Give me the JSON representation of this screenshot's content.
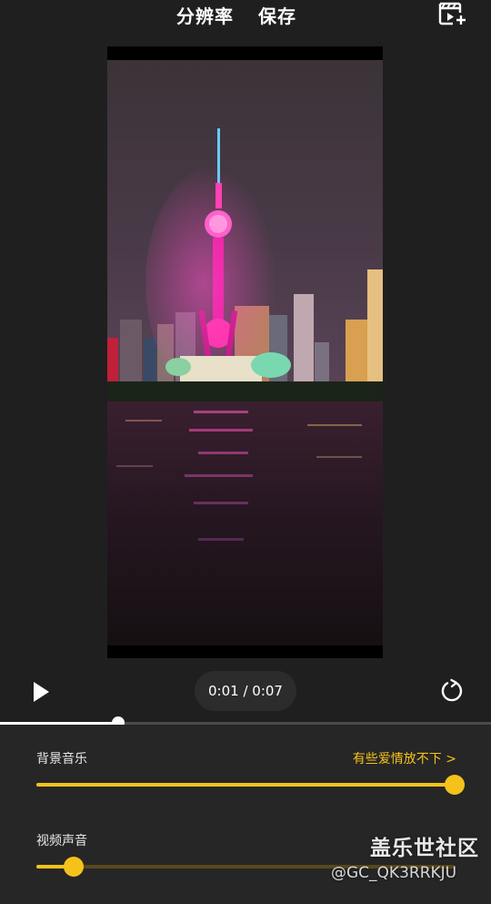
{
  "header": {
    "resolution_label": "分辨率",
    "save_label": "保存",
    "add_clip_icon": "add-video-clip-icon"
  },
  "preview": {
    "description_icon": "video-frame"
  },
  "playback": {
    "time_display": "0:01 / 0:07",
    "progress_fraction": 0.24,
    "play_icon": "play-icon",
    "replay_icon": "replay-icon"
  },
  "audio": {
    "background_music": {
      "label": "背景音乐",
      "track_name": "有些爱情放不下 >",
      "level": 1.0
    },
    "video_sound": {
      "label": "视频声音",
      "level": 0.09
    }
  },
  "watermark": {
    "title": "盖乐世社区",
    "handle": "@GC_QK3RRKJU"
  },
  "colors": {
    "accent": "#f5c21b",
    "background": "#1f1f1f",
    "panel": "#262626"
  }
}
